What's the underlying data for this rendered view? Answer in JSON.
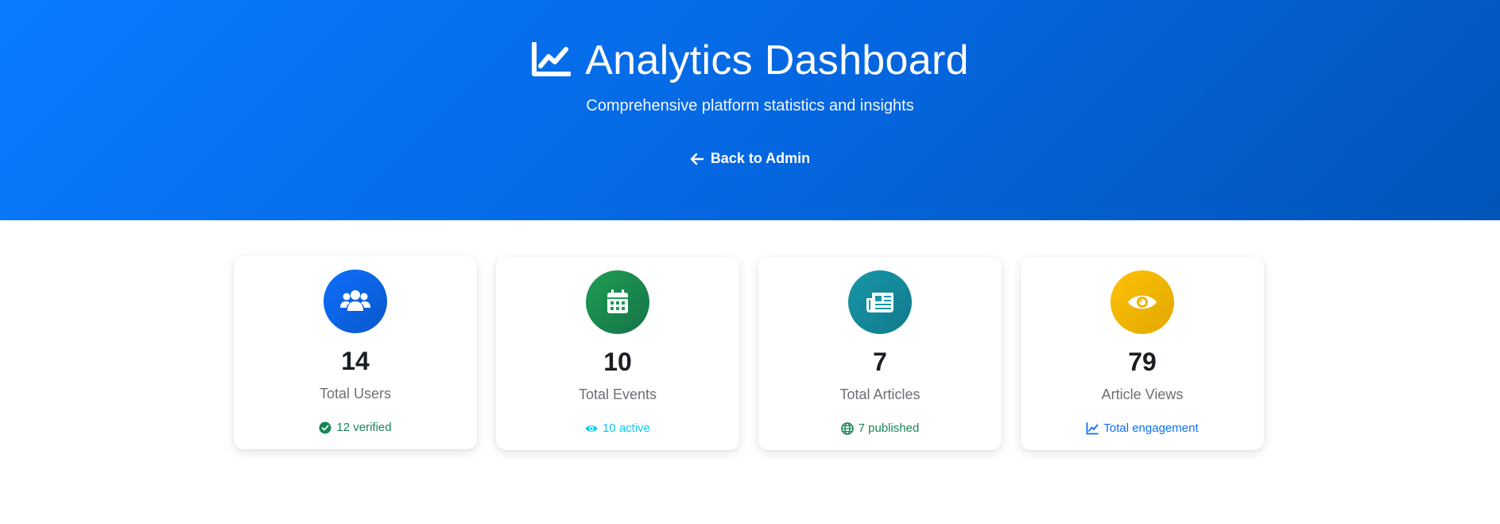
{
  "header": {
    "title": "Analytics Dashboard",
    "subtitle": "Comprehensive platform statistics and insights",
    "back_label": "Back to Admin",
    "title_icon": "chart-line-icon",
    "back_icon": "arrow-left-icon"
  },
  "colors": {
    "hero_start": "#0a7bff",
    "hero_end": "#0254b8",
    "users": "#0d6efd",
    "events": "#198754",
    "articles": "#138496",
    "views": "#ffc107",
    "verified_text": "#198754",
    "active_text": "#0dcaf0",
    "published_text": "#198754",
    "engagement_text": "#0d6efd"
  },
  "stats": [
    {
      "icon": "users-icon",
      "value": "14",
      "label": "Total Users",
      "sub_icon": "check-circle-icon",
      "sub_text": "12 verified"
    },
    {
      "icon": "calendar-icon",
      "value": "10",
      "label": "Total Events",
      "sub_icon": "eye-icon",
      "sub_text": "10 active"
    },
    {
      "icon": "newspaper-icon",
      "value": "7",
      "label": "Total Articles",
      "sub_icon": "globe-icon",
      "sub_text": "7 published"
    },
    {
      "icon": "eye-icon",
      "value": "79",
      "label": "Article Views",
      "sub_icon": "chart-line-icon",
      "sub_text": "Total engagement"
    }
  ]
}
